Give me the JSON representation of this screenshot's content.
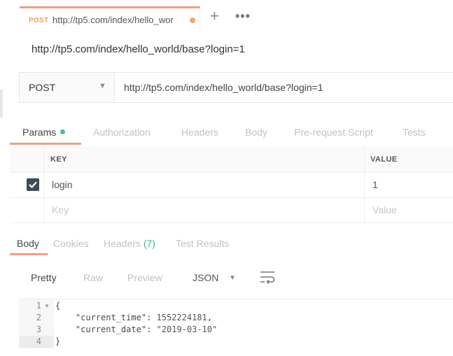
{
  "request_tab": {
    "method": "POST",
    "url": "http://tp5.com/index/hello_wor"
  },
  "toolbar_top": {
    "new_tab": "+",
    "more": "•••"
  },
  "request_title": "http://tp5.com/index/hello_world/base?login=1",
  "url_bar": {
    "method": "POST",
    "url": "http://tp5.com/index/hello_world/base?login=1"
  },
  "request_tabs": [
    "Params",
    "Authorization",
    "Headers",
    "Body",
    "Pre-request Script",
    "Tests"
  ],
  "params": {
    "headers": {
      "key": "KEY",
      "value": "VALUE"
    },
    "rows": [
      {
        "key": "login",
        "value": "1",
        "checked": true
      }
    ],
    "placeholder": {
      "key": "Key",
      "value": "Value"
    }
  },
  "response_tabs": {
    "body": "Body",
    "cookies": "Cookies",
    "headers": "Headers",
    "headers_count": "(7)",
    "tests": "Test Results"
  },
  "response_toolbar": {
    "pretty": "Pretty",
    "raw": "Raw",
    "preview": "Preview",
    "format": "JSON"
  },
  "response_body": {
    "line_numbers": [
      "1",
      "2",
      "3",
      "4"
    ],
    "open": "{",
    "k1": "\"current_time\"",
    "v1": "1552224181",
    "k2": "\"current_date\"",
    "v2": "\"2019-03-10\"",
    "close": "}"
  },
  "colors": {
    "accent": "#f09d89",
    "method": "#f0a35b",
    "green": "#47c28a"
  },
  "icons": [
    "plus-icon",
    "more-icon",
    "chevron-down-icon",
    "checkbox-icon",
    "wrap-lines-icon",
    "fold-arrow-icon"
  ]
}
